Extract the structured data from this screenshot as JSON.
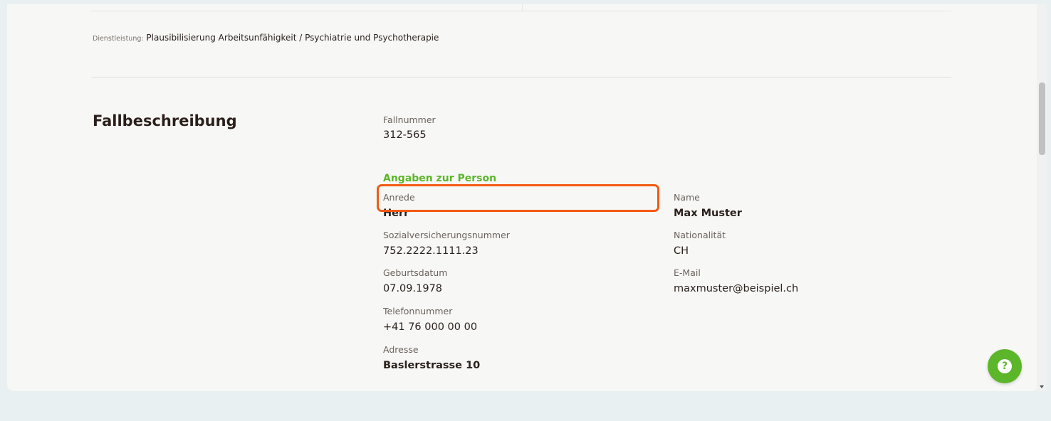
{
  "service": {
    "label": "Dienstleistung:",
    "value": "Plausibilisierung Arbeitsunfähigkeit / Psychiatrie und Psychotherapie"
  },
  "section": {
    "title": "Fallbeschreibung"
  },
  "case": {
    "number_label": "Fallnummer",
    "number_value": "312-565"
  },
  "person": {
    "heading": "Angaben zur Person",
    "salutation_label": "Anrede",
    "salutation_value": "Herr",
    "name_label": "Name",
    "name_value": "Max Muster",
    "ssn_label": "Sozialversicherungsnummer",
    "ssn_value": "752.2222.1111.23",
    "nationality_label": "Nationalität",
    "nationality_value": "CH",
    "birthdate_label": "Geburtsdatum",
    "birthdate_value": "07.09.1978",
    "email_label": "E-Mail",
    "email_value": "maxmuster@beispiel.ch",
    "phone_label": "Telefonnummer",
    "phone_value": "+41 76 000 00 00",
    "address_label": "Adresse",
    "address_value": "Baslerstrasse 10"
  },
  "help": {
    "icon": "question-icon",
    "glyph": "?"
  },
  "colors": {
    "accent_green": "#5cb62a",
    "highlight_orange": "#f25a14",
    "background": "#e9f0f2",
    "card": "#f7f7f5"
  }
}
